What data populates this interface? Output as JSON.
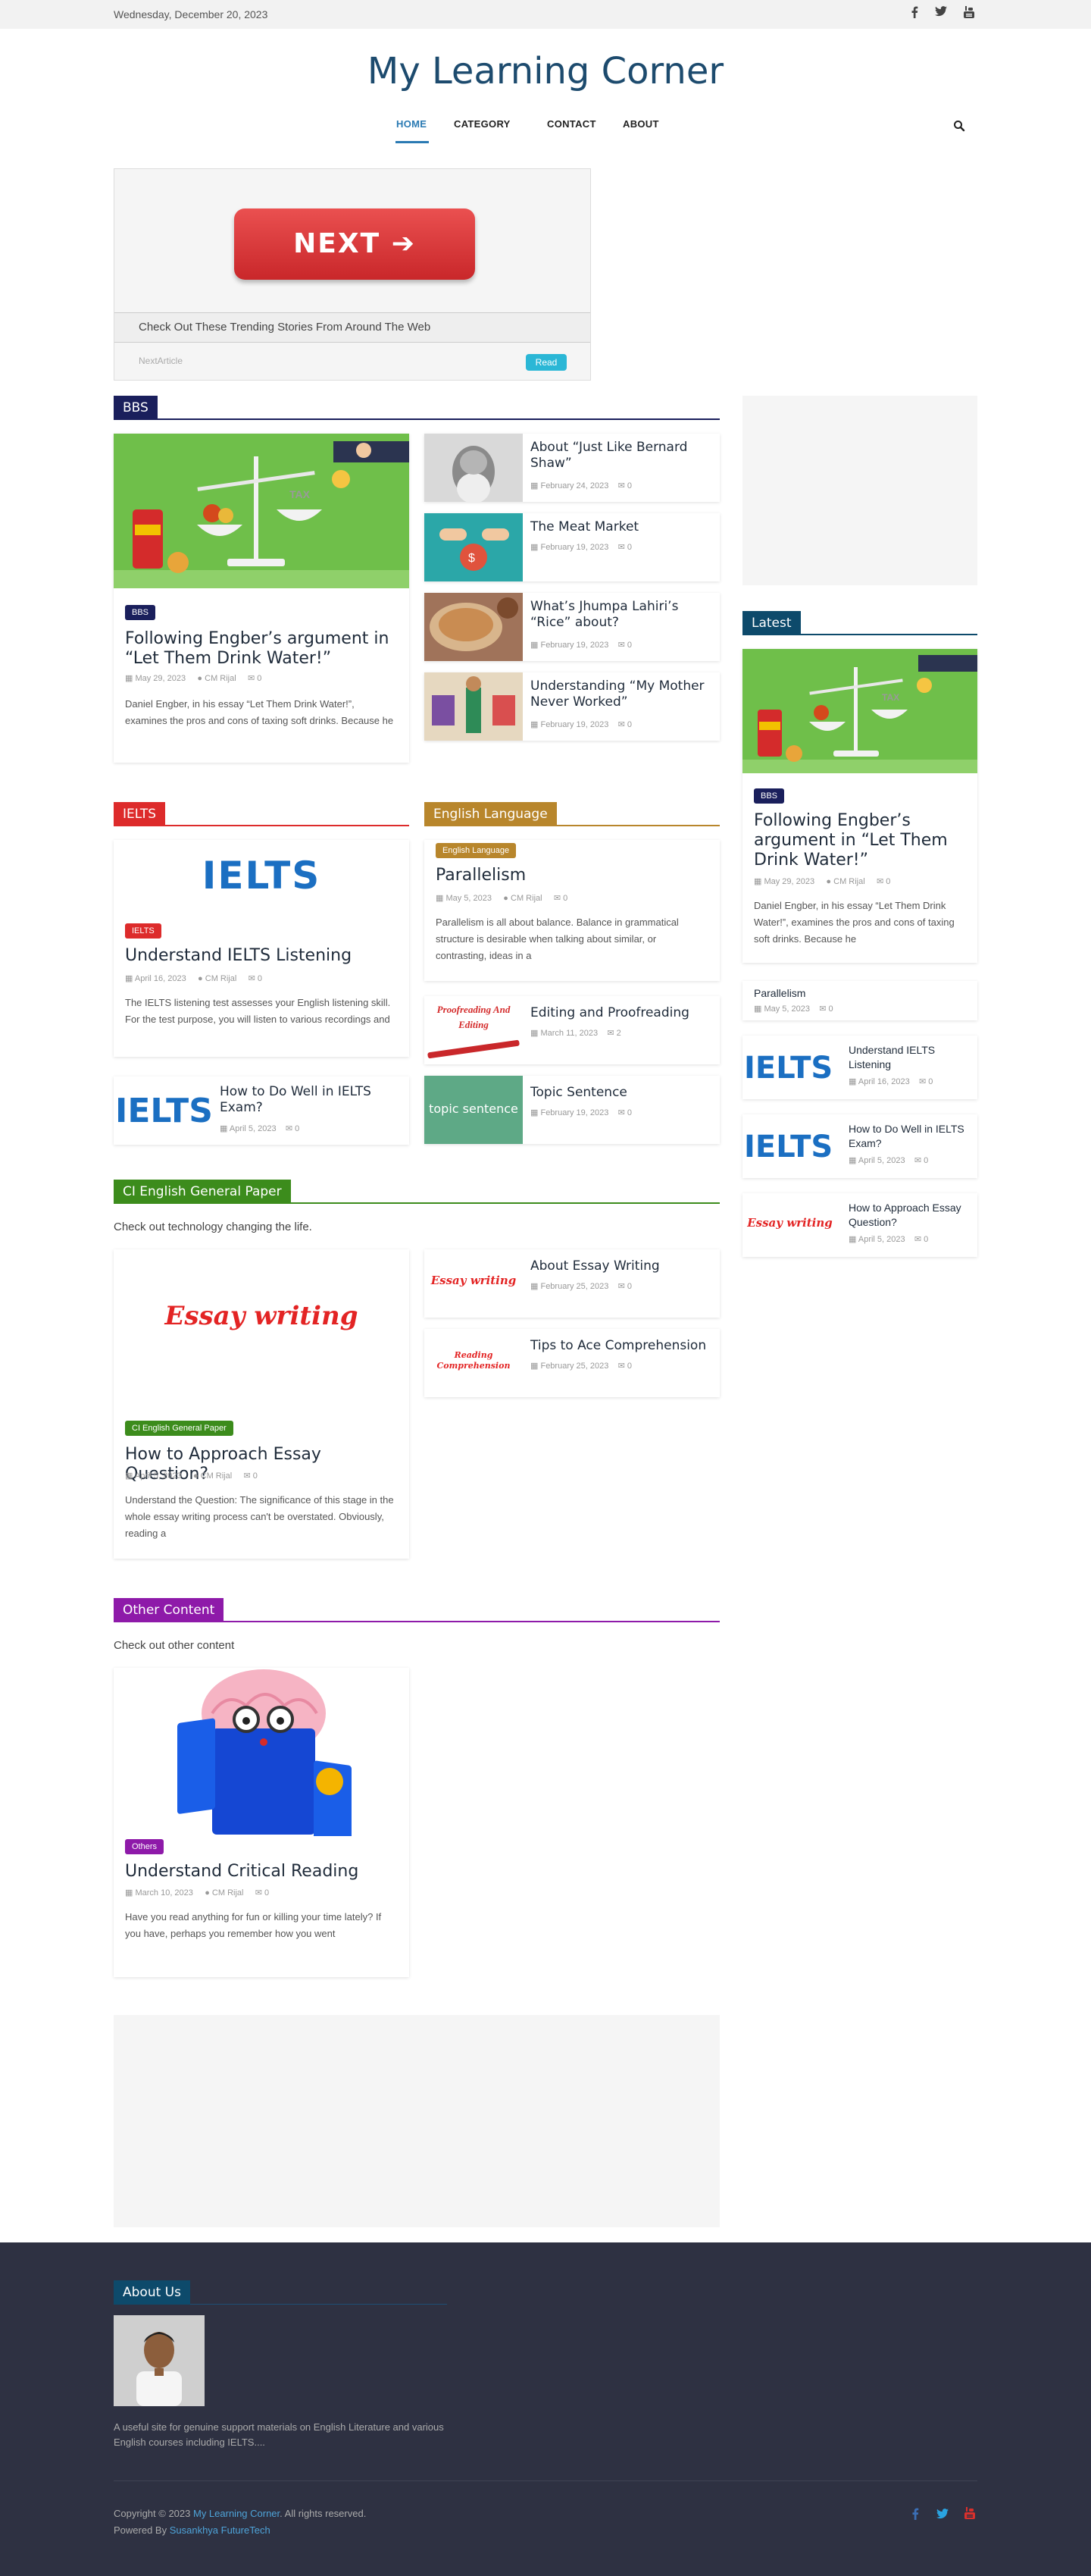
{
  "topbar": {
    "date": "Wednesday, December 20, 2023"
  },
  "site": {
    "title": "My Learning Corner"
  },
  "nav": {
    "home": "HOME",
    "category": "CATEGORY",
    "contact": "CONTACT",
    "about": "ABOUT"
  },
  "ad": {
    "button": "NEXT ➔",
    "strip": "Check Out These Trending Stories From Around The Web",
    "foot": "NextArticle",
    "read": "Read"
  },
  "bbs": {
    "heading": "BBS",
    "main": {
      "badge": "BBS",
      "title": "Following Engber’s argument in “Let Them Drink Water!”",
      "date": "May 29, 2023",
      "author": "CM Rijal",
      "comments": "0",
      "excerpt": "Daniel Engber, in his essay “Let Them Drink Water!”, examines the pros and cons of taxing soft drinks. Because he"
    },
    "side": [
      {
        "title": "About “Just Like Bernard Shaw”",
        "date": "February 24, 2023",
        "comments": "0"
      },
      {
        "title": "The Meat Market",
        "date": "February 19, 2023",
        "comments": "0"
      },
      {
        "title": "What’s Jhumpa Lahiri’s “Rice” about?",
        "date": "February 19, 2023",
        "comments": "0"
      },
      {
        "title": "Understanding “My Mother Never Worked”",
        "date": "February 19, 2023",
        "comments": "0"
      }
    ]
  },
  "ielts": {
    "heading": "IELTS",
    "logo": "IELTS",
    "main": {
      "badge": "IELTS",
      "title": "Understand IELTS Listening",
      "date": "April 16, 2023",
      "author": "CM Rijal",
      "comments": "0",
      "excerpt": "The IELTS listening test assesses your English listening skill. For the test purpose, you will listen to various recordings and"
    },
    "side": {
      "logo": "IELTS",
      "title": "How to Do Well in IELTS Exam?",
      "date": "April 5, 2023",
      "comments": "0"
    }
  },
  "english": {
    "heading": "English Language",
    "main": {
      "badge": "English Language",
      "title": "Parallelism",
      "date": "May 5, 2023",
      "author": "CM Rijal",
      "comments": "0",
      "excerpt": "Parallelism is all about balance. Balance in grammatical structure is desirable when talking about similar, or contrasting, ideas in a"
    },
    "side": [
      {
        "thumb": "Proofreading And Editing",
        "title": "Editing and Proofreading",
        "date": "March 11, 2023",
        "comments": "2"
      },
      {
        "thumb": "topic sentence",
        "title": "Topic Sentence",
        "date": "February 19, 2023",
        "comments": "0"
      }
    ]
  },
  "ci": {
    "heading": "CI English General Paper",
    "desc": "Check out technology changing the life.",
    "main": {
      "thumb": "Essay writing",
      "badge": "CI English General Paper",
      "title": "How to Approach Essay Question?",
      "date": "April 5, 2023",
      "author": "CM Rijal",
      "comments": "0",
      "excerpt": "Understand the Question: The significance of this stage in the whole essay writing process can't be overstated. Obviously, reading a"
    },
    "side": [
      {
        "thumb": "Essay writing",
        "title": "About Essay Writing",
        "date": "February 25, 2023",
        "comments": "0"
      },
      {
        "thumb": "Reading Comprehension",
        "title": "Tips to Ace Comprehension",
        "date": "February 25, 2023",
        "comments": "0"
      }
    ]
  },
  "other": {
    "heading": "Other Content",
    "desc": "Check out other content",
    "main": {
      "badge": "Others",
      "title": "Understand Critical Reading",
      "date": "March 10, 2023",
      "author": "CM Rijal",
      "comments": "0",
      "excerpt": "Have you read anything for fun or killing your time lately? If you have, perhaps you remember how you went"
    }
  },
  "sidebar": {
    "latest_heading": "Latest",
    "main": {
      "badge": "BBS",
      "title": "Following Engber’s argument in “Let Them Drink Water!”",
      "date": "May 29, 2023",
      "author": "CM Rijal",
      "comments": "0",
      "excerpt": "Daniel Engber, in his essay “Let Them Drink Water!”, examines the pros and cons of taxing soft drinks. Because he"
    },
    "parallelism": {
      "title": "Parallelism",
      "date": "May 5, 2023",
      "comments": "0"
    },
    "items": [
      {
        "thumb": "IELTS",
        "title": "Understand IELTS Listening",
        "date": "April 16, 2023",
        "comments": "0"
      },
      {
        "thumb": "IELTS",
        "title": "How to Do Well in IELTS Exam?",
        "date": "April 5, 2023",
        "comments": "0"
      },
      {
        "thumb": "Essay writing",
        "title": "How to Approach Essay Question?",
        "date": "April 5, 2023",
        "comments": "0"
      }
    ]
  },
  "footer": {
    "about_heading": "About Us",
    "about_text": "A useful site for genuine support materials on English Literature and various English courses including IELTS....",
    "copyright_prefix": "Copyright © 2023 ",
    "copyright_link": "My Learning Corner",
    "copyright_suffix": ". All rights reserved.",
    "powered_prefix": "Powered By ",
    "powered_link": "Susankhya FutureTech"
  },
  "colors": {
    "bbs": "#1a1f5c",
    "ielts": "#dd2b2b",
    "english": "#b8862c",
    "ci": "#3c8c1c",
    "other": "#8e1aa9",
    "latest": "#0d4a6b",
    "footer_bg": "#2e3142"
  },
  "icons": {
    "facebook": "facebook-icon",
    "twitter": "twitter-icon",
    "youtube": "youtube-icon",
    "search": "search-icon",
    "calendar": "calendar-icon",
    "user": "user-icon",
    "comment": "comment-icon"
  }
}
